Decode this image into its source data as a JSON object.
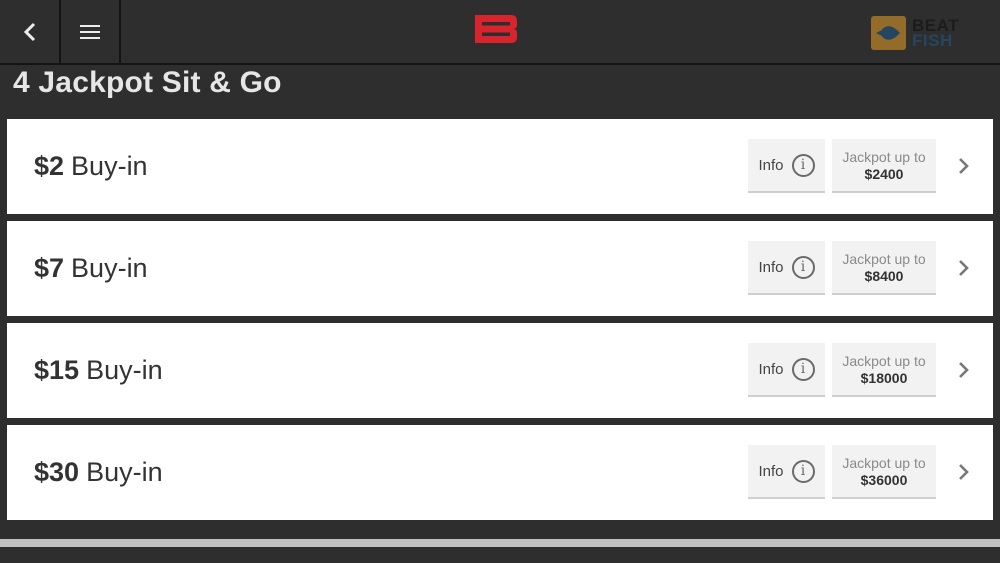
{
  "header": {
    "back_icon": "chevron-left-icon",
    "menu_icon": "hamburger-menu-icon",
    "brand_logo": "B",
    "brand_color": "#d8242c",
    "partner_logo": {
      "line1": "BEAT",
      "line2": "FISH",
      "icon": "spade-icon"
    }
  },
  "page": {
    "title": "4 Jackpot Sit & Go"
  },
  "games": [
    {
      "amount": "$2",
      "suffix": "Buy-in",
      "info_label": "Info",
      "jackpot_label": "Jackpot up to",
      "jackpot_value": "$2400"
    },
    {
      "amount": "$7",
      "suffix": "Buy-in",
      "info_label": "Info",
      "jackpot_label": "Jackpot up to",
      "jackpot_value": "$8400"
    },
    {
      "amount": "$15",
      "suffix": "Buy-in",
      "info_label": "Info",
      "jackpot_label": "Jackpot up to",
      "jackpot_value": "$18000"
    },
    {
      "amount": "$30",
      "suffix": "Buy-in",
      "info_label": "Info",
      "jackpot_label": "Jackpot up to",
      "jackpot_value": "$36000"
    }
  ],
  "icons": {
    "info": "i"
  }
}
